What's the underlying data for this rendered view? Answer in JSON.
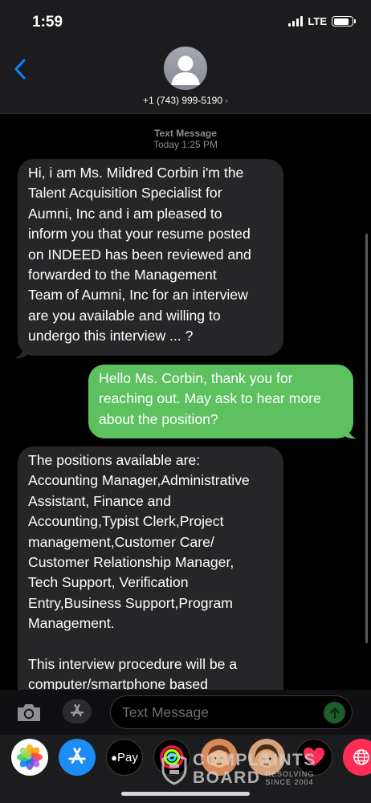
{
  "status_bar": {
    "time": "1:59",
    "network": "LTE",
    "battery_level": 0.85
  },
  "header": {
    "contact": "+1 (743) 999-5190",
    "chevron": "›"
  },
  "thread": {
    "service": "Text Message",
    "timestamp": "Today 1:25 PM",
    "messages": [
      {
        "direction": "incoming",
        "lines": [
          "Hi, i am Ms. Mildred Corbin i'm the",
          "Talent Acquisition Specialist for",
          "Aumni, Inc and i am pleased to",
          "inform you that your resume posted",
          "on INDEED has been reviewed and",
          "forwarded to the Management",
          "Team of Aumni, Inc for an interview",
          "are you available and willing to",
          "undergo this interview ... ?"
        ]
      },
      {
        "direction": "outgoing",
        "lines": [
          "Hello Ms. Corbin, thank you for",
          "reaching out. May ask to hear more",
          "about the position?"
        ]
      },
      {
        "direction": "incoming",
        "lines": [
          "The positions available are:",
          "Accounting Manager,Administrative",
          "Assistant, Finance and",
          "Accounting,Typist Clerk,Project",
          "management,Customer Care/",
          "Customer Relationship Manager,",
          "Tech Support, Verification",
          "Entry,Business Support,Program",
          "Management.",
          "",
          "This interview procedure will be a",
          "computer/smartphone based"
        ]
      }
    ]
  },
  "input_bar": {
    "placeholder": "Text Message"
  },
  "icons": {
    "back": "chevron-left-icon",
    "camera": "camera-icon",
    "app_store": "app-store-icon",
    "send": "send-arrow-icon"
  },
  "app_drawer": {
    "apps": [
      {
        "name": "photos-icon"
      },
      {
        "name": "app-store-app-icon"
      },
      {
        "name": "apple-pay-icon",
        "label": "Pay"
      },
      {
        "name": "activity-icon"
      },
      {
        "name": "memoji-icon"
      },
      {
        "name": "memoji-icon-2"
      },
      {
        "name": "digital-touch-icon"
      },
      {
        "name": "web-icon"
      }
    ]
  },
  "watermark": {
    "line1": "COMPLAINTS",
    "line2": "BOARD",
    "tag1": "RESOLVING",
    "tag2": "SINCE 2004"
  },
  "colors": {
    "incoming_bubble": "#262628",
    "outgoing_bubble": "#5dc160",
    "accent": "#0a84ff"
  }
}
